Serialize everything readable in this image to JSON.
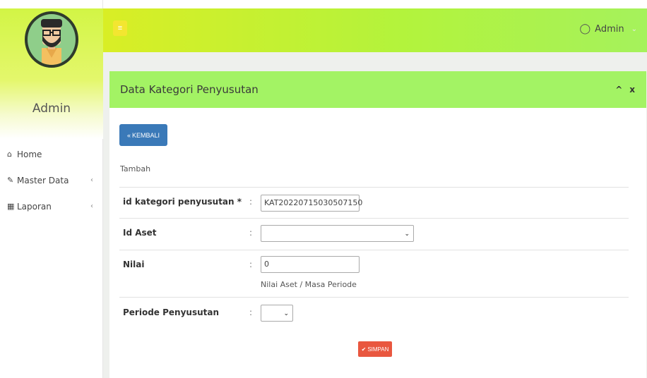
{
  "sidebar": {
    "user_name": "Admin",
    "menu": [
      {
        "icon": "home-icon",
        "glyph": "⌂",
        "label": "Home",
        "chevron": ""
      },
      {
        "icon": "edit-icon",
        "glyph": "✎",
        "label": "Master Data",
        "chevron": "‹"
      },
      {
        "icon": "calendar-icon",
        "glyph": "▦",
        "label": "Laporan",
        "chevron": "‹"
      }
    ]
  },
  "topbar": {
    "toggle_glyph": "≡",
    "user_icon_glyph": "◯",
    "user_name": "Admin",
    "caret": "⌄"
  },
  "panel": {
    "title": "Data Kategori Penyusutan",
    "collapse_glyph": "^",
    "close_glyph": "x",
    "back_button": {
      "icon_glyph": "«",
      "label": "KEMBALI"
    },
    "subtitle": "Tambah",
    "fields": {
      "id_kategori": {
        "label": "id kategori penyusutan *",
        "colon": ":",
        "value": "KAT20220715030507150"
      },
      "id_aset": {
        "label": "Id Aset",
        "colon": ":",
        "value": ""
      },
      "nilai": {
        "label": "Nilai",
        "colon": ":",
        "value": "0",
        "help": "Nilai Aset / Masa Periode"
      },
      "periode": {
        "label": "Periode Penyusutan",
        "colon": ":",
        "value": ""
      }
    },
    "save_button": {
      "icon_glyph": "✔",
      "label": "SIMPAN"
    }
  },
  "colors": {
    "topbar_left": "#d9ee25",
    "topbar_right": "#a5f25c",
    "panel_heading": "#a3f364",
    "back_button": "#3a79b8",
    "save_button": "#e9573f",
    "toggle_button": "#f3e630"
  }
}
